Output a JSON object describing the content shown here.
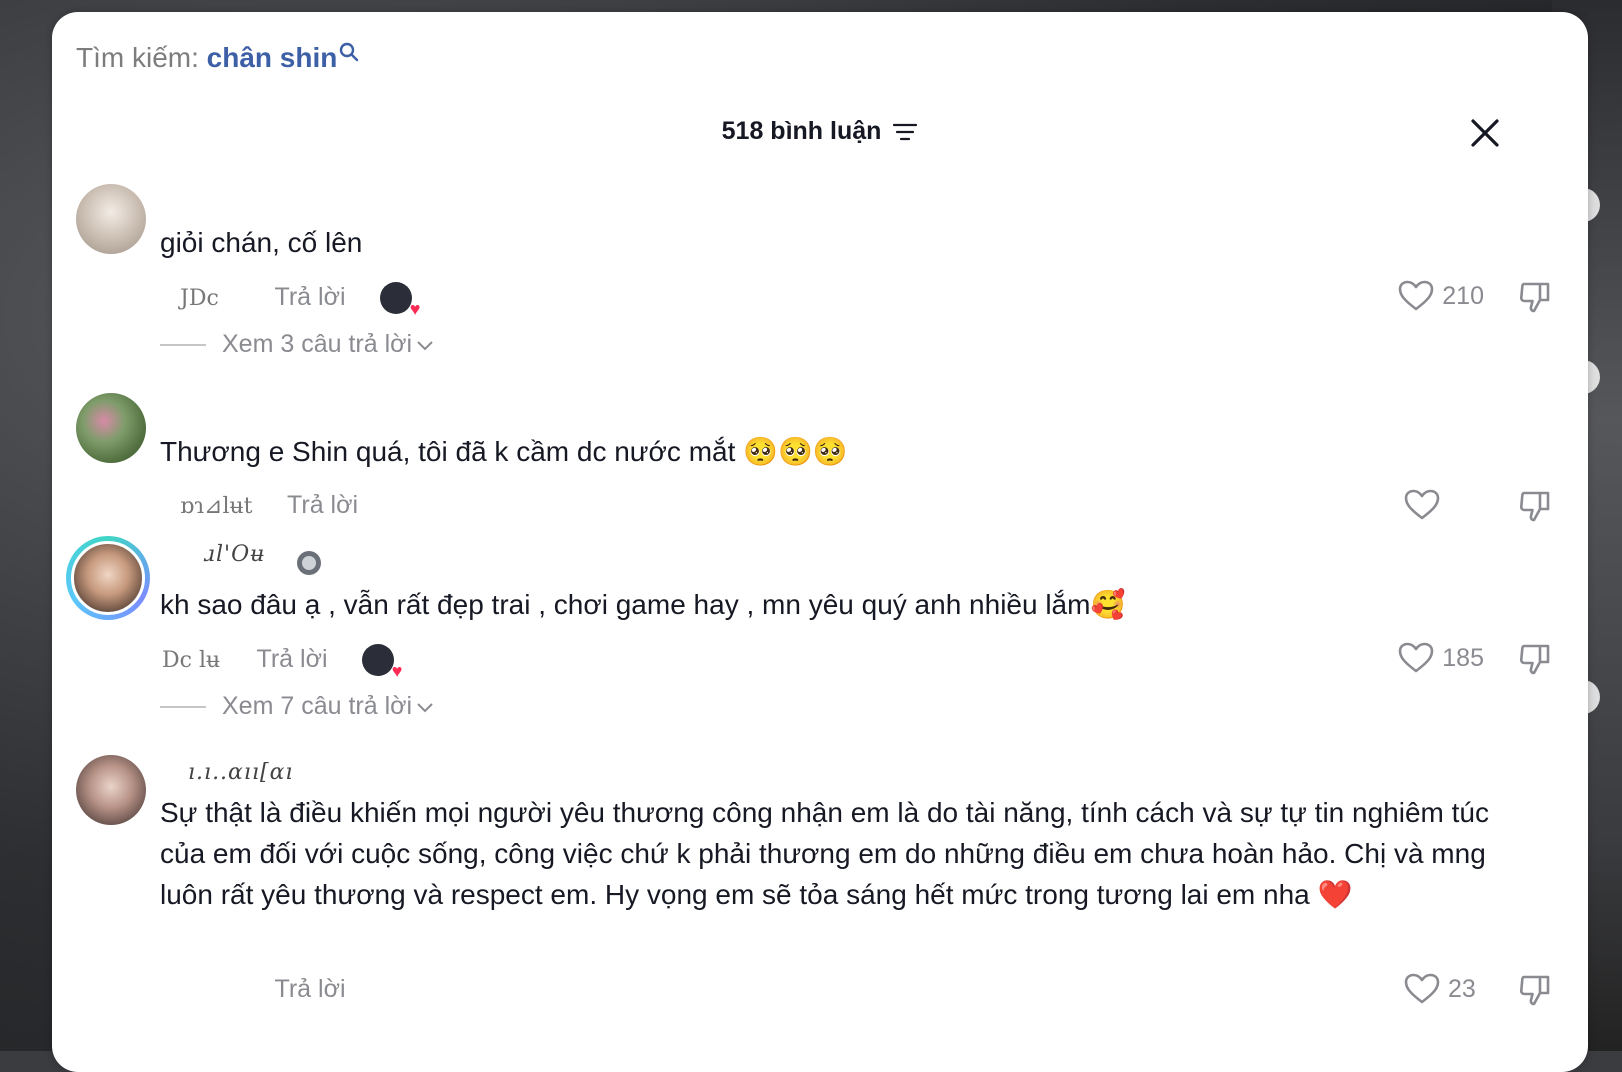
{
  "search": {
    "label": "Tìm kiếm:",
    "term": "chân shin"
  },
  "header": {
    "count_label": "518 bình luận"
  },
  "comments": [
    {
      "username": "",
      "text": "giỏi chán, cố lên",
      "date": "JDc",
      "reply_label": "Trả lời",
      "likes": "210",
      "view_replies": "Xem 3 câu trả lời"
    },
    {
      "username": "",
      "text": "Thương e Shin quá, tôi đã k cầm dc nước mắt 🥺🥺🥺",
      "date": "ɒɿ⊿lʉt",
      "reply_label": "Trả lời",
      "likes": ""
    },
    {
      "username": "ɹl'Oʉ",
      "text": "kh sao đâu ạ , vẫn rất đẹp trai , chơi game hay , mn yêu quý anh nhiều lắm🥰",
      "date": "Dc lʉ",
      "reply_label": "Trả lời",
      "likes": "185",
      "view_replies": "Xem 7 câu trả lời"
    },
    {
      "username": "ı.ı..ɑıı[ɑı",
      "text": "Sự thật là điều khiến mọi người yêu thương công nhận em là do tài năng, tính cách và sự tự tin nghiêm túc của em đối với cuộc sống, công việc chứ k phải thương em do những điều em chưa hoàn hảo. Chị và mng luôn rất yêu thương và respect em. Hy vọng em sẽ tỏa sáng hết mức trong tương lai em nha ❤️",
      "date": "",
      "reply_label": "Trả lời",
      "likes": "23"
    }
  ],
  "colors": {
    "accent": "#3c5fa6",
    "text": "#161823",
    "muted": "#8a8b91",
    "heart": "#fe2c55"
  }
}
